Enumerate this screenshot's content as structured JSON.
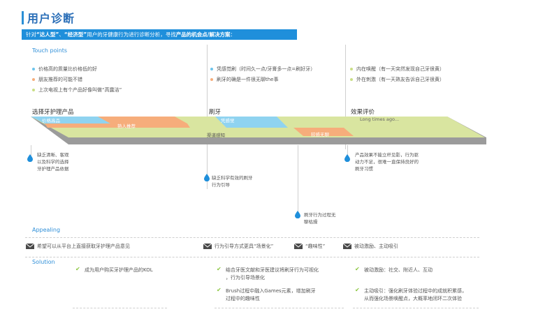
{
  "header": {
    "title": "用户诊断"
  },
  "banner": {
    "prefix": "针对",
    "highlight1": "“达人型”",
    "sep": "、",
    "highlight2": "“经济型”",
    "middle": "用户的牙健康行为进行诊断分析，寻找",
    "highlight3": "产品的机会点/解决方案",
    "suffix": "："
  },
  "touch_points": {
    "label": "Touch points",
    "col1": [
      "价格高的质量比价格低的好",
      "朋友推荐的可能不错",
      "上次电视上有个产品好像叫做“高露洁”"
    ],
    "col2": [
      "凭感觉刷（时间久一点/牙膏多一点=刷好牙）",
      "刷牙的确是一件很无聊the事"
    ],
    "col3": [
      "内在唤醒（有一天突然发现自己牙很黄）",
      "外在刺激（有一天熟友告诉自己牙很黄）"
    ]
  },
  "stages": [
    "选择牙护理产品",
    "刷牙",
    "效果评价"
  ],
  "track": {
    "seg_price": "价格高品",
    "seg_expert": "熟人推荐",
    "seg_feel": "凭感觉",
    "seg_channel": "渠道感知",
    "seg_boring": "较感无聊",
    "seg_long": "Long times ago..."
  },
  "pain_points": {
    "p1": [
      "缺乏清晰、客观",
      "以及科学的选择",
      "牙护理产品依据"
    ],
    "p2": [
      "缺乏科学有效的刷牙",
      "行为引导"
    ],
    "p3": [
      "刷牙行为过程无",
      "聊枯燥"
    ],
    "p4": [
      "产品效果不能立杆见影，行为驱",
      "动力不足，很难一直保持良好的",
      "刷牙习惯"
    ]
  },
  "appealing": {
    "label": "Appealing",
    "items": [
      "希望可以从平台上直接获取牙护理产品意见",
      "行为引导方式更具“场景化”",
      "“趣味性”",
      "被动激励、主动吸引"
    ]
  },
  "solution": {
    "label": "Solution",
    "col1": [
      "成为用户购买牙护理产品的KOL"
    ],
    "col2a": [
      "结合牙医文献和牙医建议将刷牙行为可视化",
      "，行为引导场景化"
    ],
    "col2b": [
      "Brush过程中融入Games元素，增加刷牙",
      "过程中的趣味性"
    ],
    "col3a": [
      "被动激励：社交、附近人、互动"
    ],
    "col3b": [
      "主动吸引：强化刷牙体验过程中的成就积累感，",
      "从而强化场景唤醒点，大概率地闭环二次体验"
    ]
  },
  "colors": {
    "accent": "#1f8fdb",
    "orange": "#f6ad7b",
    "green": "#d9e5a0",
    "blue": "#8fd3f0",
    "gray": "#9b9b9b",
    "check": "#8bc63f",
    "dot_blue": "#6cc4ec",
    "dot_orange": "#f6ad7b",
    "dot_green": "#c9de86"
  }
}
